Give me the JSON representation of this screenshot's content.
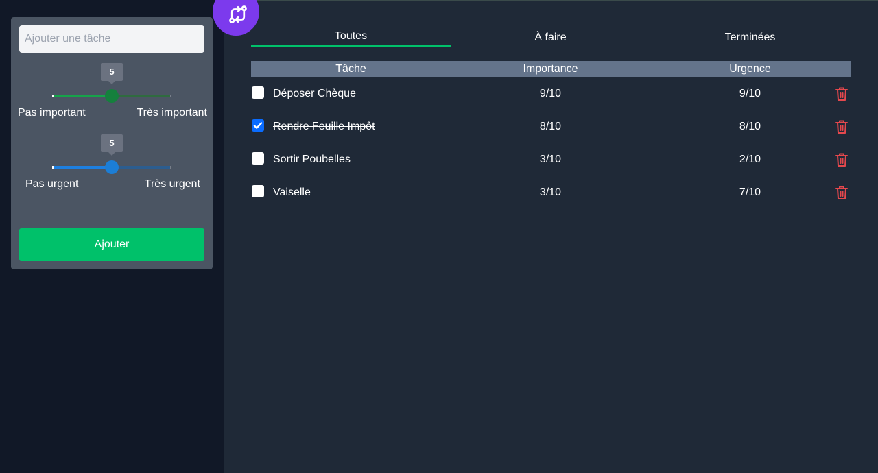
{
  "form": {
    "task_placeholder": "Ajouter une tâche",
    "importance": {
      "value": 5,
      "min_label": "Pas important",
      "max_label": "Très important",
      "fraction": 0.5
    },
    "urgency": {
      "value": 5,
      "min_label": "Pas urgent",
      "max_label": "Très urgent",
      "fraction": 0.5
    },
    "add_label": "Ajouter"
  },
  "tabs": [
    {
      "label": "Toutes",
      "active": true
    },
    {
      "label": "À faire",
      "active": false
    },
    {
      "label": "Terminées",
      "active": false
    }
  ],
  "table": {
    "headers": [
      "Tâche",
      "Importance",
      "Urgence"
    ],
    "rows": [
      {
        "name": "Déposer Chèque",
        "done": false,
        "importance": "9/10",
        "urgency": "9/10"
      },
      {
        "name": "Rendre Feuille Impôt",
        "done": true,
        "importance": "8/10",
        "urgency": "8/10"
      },
      {
        "name": "Sortir Poubelles",
        "done": false,
        "importance": "3/10",
        "urgency": "2/10"
      },
      {
        "name": "Vaiselle",
        "done": false,
        "importance": "3/10",
        "urgency": "7/10"
      }
    ]
  },
  "colors": {
    "accent": "#00c16a",
    "importance": "#16a34a",
    "urgency": "#1d7fe0",
    "danger": "#e5484d",
    "logo": "#7c3aed"
  },
  "icons": {
    "logo": "git-compare-icon",
    "delete": "trash-icon",
    "check": "check-icon"
  }
}
